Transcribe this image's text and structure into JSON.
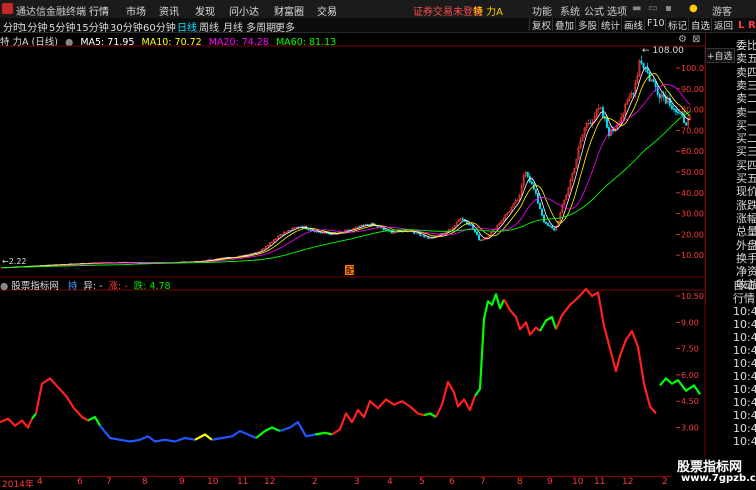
{
  "titlebar": {
    "app_name": "通达信金融终端",
    "menus": [
      "行情",
      "市场",
      "资讯",
      "发现",
      "问小达",
      "财富圈",
      "交易"
    ],
    "alert": "证券交易未登录",
    "stock": "特 力A",
    "right_menus": [
      "功能",
      "系统",
      "公式",
      "选项"
    ],
    "user": "游客"
  },
  "toolbar": {
    "periods": [
      "分时",
      "1分钟",
      "5分钟",
      "15分钟",
      "30分钟",
      "60分钟",
      "日线",
      "周线",
      "月线",
      "多周期",
      "更多"
    ],
    "active_period": "日线",
    "buttons": [
      "复权",
      "叠加",
      "多股",
      "统计",
      "画线",
      "F10",
      "标记",
      "自选",
      "返回"
    ]
  },
  "ma_row": {
    "title": "特 力A (日线)",
    "ma5": "MA5: 71.95",
    "ma10": "MA10: 70.72",
    "ma20": "MA20: 74.28",
    "ma60": "MA60: 81.13"
  },
  "price_axis": [
    "100.0",
    "90.00",
    "80.00",
    "70.00",
    "60.00",
    "50.00",
    "40.00",
    "30.00",
    "20.00",
    "10.00"
  ],
  "annotations": {
    "high": "108.00",
    "low": "2.22",
    "marker": "配"
  },
  "order_book": [
    "委比",
    "卖五",
    "卖四",
    "卖三",
    "卖二",
    "卖一",
    "买一",
    "买二",
    "买三",
    "买四",
    "买五",
    "现价",
    "涨跌",
    "涨幅",
    "总量",
    "外盘",
    "换手",
    "净资",
    "收益"
  ],
  "book_side_markers": {
    "top_left": "L",
    "top_right": "R"
  },
  "right_panel_button": "+自选",
  "indicator": {
    "name": "股票指标网",
    "items": [
      {
        "label": "持",
        "color": "#4da3ff"
      },
      {
        "label": "异: -",
        "color": "#ddd"
      },
      {
        "label": "涨: -",
        "color": "#ff3b3b"
      },
      {
        "label": "跌: 4.78",
        "color": "#00e000"
      }
    ],
    "axis": [
      "10.50",
      "9.00",
      "7.50",
      "6.00",
      "4.50",
      "3.00"
    ]
  },
  "lower_side": [
    "自动",
    "行情",
    "10:4",
    "10:4",
    "10:4",
    "10:4",
    "10:4",
    "10:4",
    "10:4",
    "10:4",
    "10:4",
    "10:4",
    "10:4"
  ],
  "watermark": {
    "line1": "股票指标网",
    "line2": "www.7gpzb.com"
  },
  "x_axis": [
    "2014年",
    "4",
    "6",
    "7",
    "8",
    "9",
    "10",
    "11",
    "12",
    "2",
    "3",
    "4",
    "5",
    "6",
    "7",
    "8",
    "9",
    "10",
    "11",
    "12",
    "2"
  ],
  "colors": {
    "up": "#ff3b3b",
    "down": "#00ff00",
    "ma5": "#ffffff",
    "ma10": "#ffff00",
    "ma20": "#ff00ff",
    "ma60": "#00ff00",
    "accent": "#00e5ff",
    "blue": "#2255ff"
  }
}
